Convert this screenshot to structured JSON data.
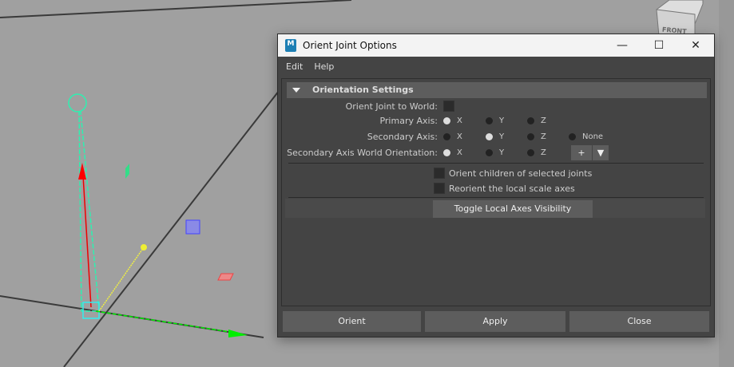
{
  "window": {
    "title": "Orient Joint Options",
    "logo_text": "M"
  },
  "menu": [
    "Edit",
    "Help"
  ],
  "section": {
    "title": "Orientation Settings"
  },
  "orient_to_world": {
    "label": "Orient Joint to World:",
    "checked": false
  },
  "primary_axis": {
    "label": "Primary Axis:",
    "options": [
      "X",
      "Y",
      "Z"
    ],
    "selected": "X"
  },
  "secondary_axis": {
    "label": "Secondary Axis:",
    "options": [
      "X",
      "Y",
      "Z",
      "None"
    ],
    "selected": "Y"
  },
  "secondary_world": {
    "label": "Secondary Axis World Orientation:",
    "options": [
      "X",
      "Y",
      "Z"
    ],
    "selected": "X",
    "sign": "+"
  },
  "checkboxes": [
    {
      "label": "Orient children of selected joints",
      "checked": false
    },
    {
      "label": "Reorient the local scale axes",
      "checked": false
    }
  ],
  "toggle_button": "Toggle Local Axes Visibility",
  "buttons": {
    "orient": "Orient",
    "apply": "Apply",
    "close": "Close"
  },
  "viewcube": {
    "face": "FRONT"
  }
}
